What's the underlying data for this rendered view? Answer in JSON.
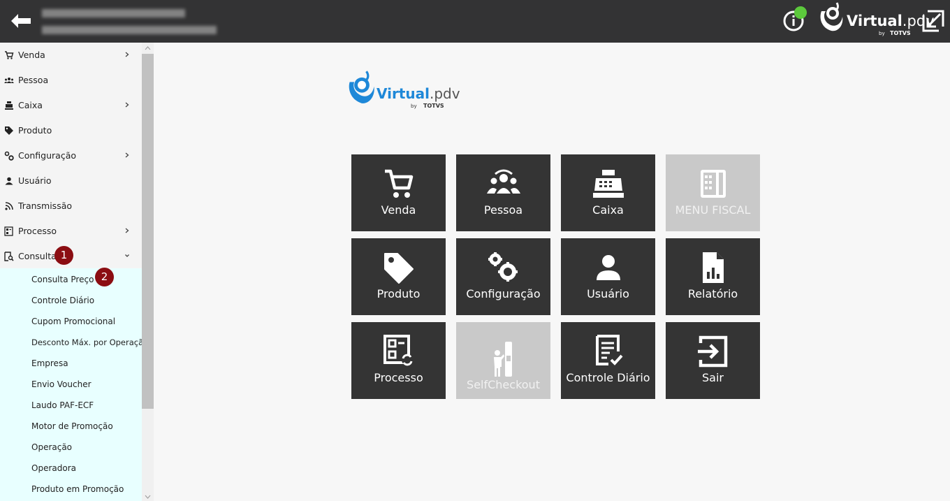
{
  "header": {
    "logo": {
      "brand_main": "Virtual",
      "brand_suffix": ".pdv",
      "by": "by",
      "company": "TOTVS"
    }
  },
  "sidebar": {
    "items": [
      {
        "label": "Venda",
        "icon": "cart-icon",
        "chevron": "right"
      },
      {
        "label": "Pessoa",
        "icon": "people-icon",
        "chevron": ""
      },
      {
        "label": "Caixa",
        "icon": "cash-register-icon",
        "chevron": "right"
      },
      {
        "label": "Produto",
        "icon": "tag-icon",
        "chevron": ""
      },
      {
        "label": "Configuração",
        "icon": "gears-icon",
        "chevron": "right"
      },
      {
        "label": "Usuário",
        "icon": "user-icon",
        "chevron": ""
      },
      {
        "label": "Transmissão",
        "icon": "broadcast-icon",
        "chevron": ""
      },
      {
        "label": "Processo",
        "icon": "process-icon",
        "chevron": "right"
      },
      {
        "label": "Consulta",
        "icon": "search-doc-icon",
        "chevron": "down"
      }
    ],
    "submenu": [
      "Consulta Preço",
      "Controle Diário",
      "Cupom Promocional",
      "Desconto Máx. por Operação",
      "Empresa",
      "Envio Voucher",
      "Laudo PAF-ECF",
      "Motor de Promoção",
      "Operação",
      "Operadora",
      "Produto em Promoção"
    ],
    "badges": [
      "1",
      "2"
    ]
  },
  "main": {
    "logo": {
      "brand_main": "Virtual",
      "brand_suffix": ".pdv",
      "by": "by",
      "company": "TOTVS"
    },
    "tiles": [
      {
        "label": "Venda",
        "icon": "cart-icon",
        "enabled": true
      },
      {
        "label": "Pessoa",
        "icon": "people-icon",
        "enabled": true
      },
      {
        "label": "Caixa",
        "icon": "cash-register-icon",
        "enabled": true
      },
      {
        "label": "MENU FISCAL",
        "icon": "calculator-icon",
        "enabled": false
      },
      {
        "label": "Produto",
        "icon": "tag-icon",
        "enabled": true
      },
      {
        "label": "Configuração",
        "icon": "gears-icon",
        "enabled": true
      },
      {
        "label": "Usuário",
        "icon": "user-icon",
        "enabled": true
      },
      {
        "label": "Relatório",
        "icon": "report-icon",
        "enabled": true
      },
      {
        "label": "Processo",
        "icon": "process-icon",
        "enabled": true
      },
      {
        "label": "SelfCheckout",
        "icon": "selfcheckout-icon",
        "enabled": false
      },
      {
        "label": "Controle Diário",
        "icon": "daily-control-icon",
        "enabled": true
      },
      {
        "label": "Sair",
        "icon": "exit-icon",
        "enabled": true
      }
    ]
  },
  "colors": {
    "header_bg": "#333334",
    "tile_bg": "#343434",
    "tile_disabled_bg": "#c9c9c9",
    "brand_blue": "#1e88d8",
    "badge_red": "#8b0d12",
    "submenu_bg": "#e8ffff",
    "status_green": "#5cc93c"
  }
}
